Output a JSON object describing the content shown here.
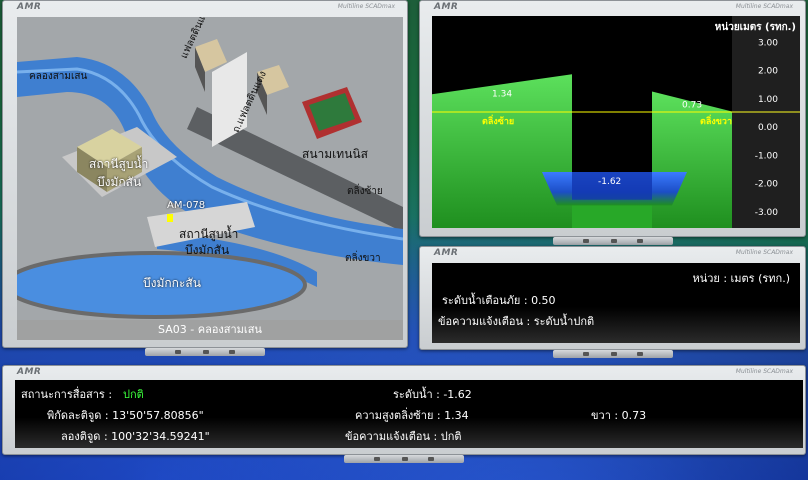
{
  "brand": "AMR",
  "panel_subtitle": "Multiline SCADmax",
  "map": {
    "footer": "SA03 - คลองสามเสน",
    "labels": {
      "canal": "คลองสามเสน",
      "flat1": "แฟลตดินแดง",
      "flat2": "ถ.แฟลตดินแดง",
      "tennis": "สนามเทนนิส",
      "pump1_l1": "สถานีสูบน้ำ",
      "pump1_l2": "บึงมักสัน",
      "station_code": "AM-078",
      "pump2_l1": "สถานีสูบน้ำ",
      "pump2_l2": "บึงมักสัน",
      "pond": "บึงมักกะสัน",
      "left_bank": "ตลิ่งซ้าย",
      "right_bank": "ตลิ่งขวา"
    }
  },
  "chart_data": {
    "type": "area",
    "title": "",
    "unit_label": "หน่วยเมตร (รทก.)",
    "ylim": [
      -3.6,
      3.4
    ],
    "y_ticks": [
      "3.00",
      "2.00",
      "1.00",
      "0.00",
      "-1.00",
      "-2.00",
      "-3.00"
    ],
    "y_tick_values": [
      3,
      2,
      1,
      0,
      -1,
      -2,
      -3
    ],
    "series": [
      {
        "name": "ตลิ่งซ้าย",
        "values": [
          1.34
        ]
      },
      {
        "name": "ตลิ่งขวา",
        "values": [
          0.73
        ]
      },
      {
        "name": "ระดับน้ำ",
        "values": [
          -1.62
        ]
      }
    ],
    "warning_level": 0.5,
    "labels": {
      "left_bank_value": "1.34",
      "right_bank_value": "0.73",
      "water_value": "-1.62",
      "left_bank_name": "ตลิ่งซ้าย",
      "right_bank_name": "ตลิ่งขวา"
    },
    "colors": {
      "bank": "#28b828",
      "water": "#1a5cff",
      "warning": "#ffff00"
    }
  },
  "alert": {
    "unit": "หน่วย : เมตร (รทก.)",
    "warning_level": "ระดับน้ำเตือนภัย : 0.50",
    "message": "ข้อความแจ้งเตือน : ระดับน้ำปกติ"
  },
  "status": {
    "comm_label": "สถานะการสื่อสาร :",
    "comm_value": "ปกติ",
    "lat": "พิกัดละติจูด : 13'50'57.80856\"",
    "lon": "ลองติจูด : 100'32'34.59241\"",
    "water_level": "ระดับน้ำ : -1.62",
    "left_height": "ความสูงตลิ่งซ้าย : 1.34",
    "message": "ข้อความแจ้งเตือน : ปกติ",
    "right": "ขวา : 0.73"
  }
}
